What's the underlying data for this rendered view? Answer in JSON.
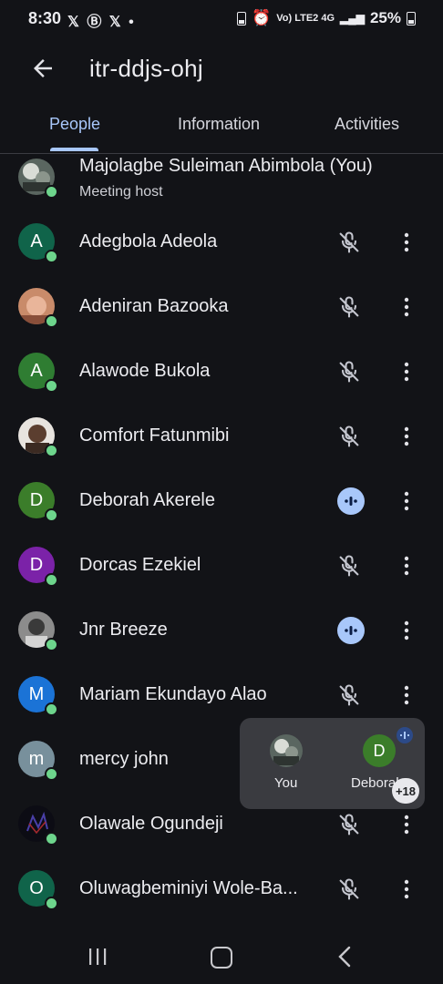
{
  "status_bar": {
    "time": "8:30",
    "notifications": "𝕏 Ⓑ 𝕏 •",
    "network": "Vo) LTE2 4G",
    "battery": "25%"
  },
  "header": {
    "title": "itr-ddjs-ohj",
    "back_icon": "arrow-left-icon"
  },
  "tabs": [
    {
      "label": "People",
      "active": true
    },
    {
      "label": "Information",
      "active": false
    },
    {
      "label": "Activities",
      "active": false
    }
  ],
  "participants": [
    {
      "name": "Majolagbe Suleiman Abimbola (You)",
      "subtitle": "Meeting host",
      "avatar": "photo",
      "initial": ""
    },
    {
      "name": "Adegbola Adeola",
      "initial": "A",
      "color": "#10644a",
      "state": "muted"
    },
    {
      "name": "Adeniran Bazooka",
      "avatar": "photo",
      "initial": "",
      "state": "muted"
    },
    {
      "name": "Alawode Bukola",
      "initial": "A",
      "color": "#2f7d32",
      "state": "muted"
    },
    {
      "name": "Comfort Fatunmibi",
      "avatar": "photo",
      "initial": "",
      "state": "muted"
    },
    {
      "name": "Deborah Akerele",
      "initial": "D",
      "color": "#3b7d2a",
      "state": "speaking"
    },
    {
      "name": "Dorcas Ezekiel",
      "initial": "D",
      "color": "#7b22a8",
      "state": "muted"
    },
    {
      "name": "Jnr Breeze",
      "avatar": "photo",
      "initial": "",
      "state": "speaking"
    },
    {
      "name": "Mariam Ekundayo Alao",
      "initial": "M",
      "color": "#1b73d6",
      "state": "muted"
    },
    {
      "name": "mercy john",
      "initial": "m",
      "color": "#78909c",
      "state": "hidden"
    },
    {
      "name": "Olawale Ogundeji",
      "avatar": "photo",
      "initial": "",
      "state": "muted"
    },
    {
      "name": "Oluwagbeminiyi Wole-Ba...",
      "initial": "O",
      "color": "#10644a",
      "state": "muted"
    }
  ],
  "floating_tile": {
    "self_label": "You",
    "other_label": "Deborah",
    "other_initial": "D",
    "more_count": "+18"
  },
  "colors": {
    "accent": "#a8c7fa",
    "online": "#6dd58c",
    "background": "#121317"
  }
}
